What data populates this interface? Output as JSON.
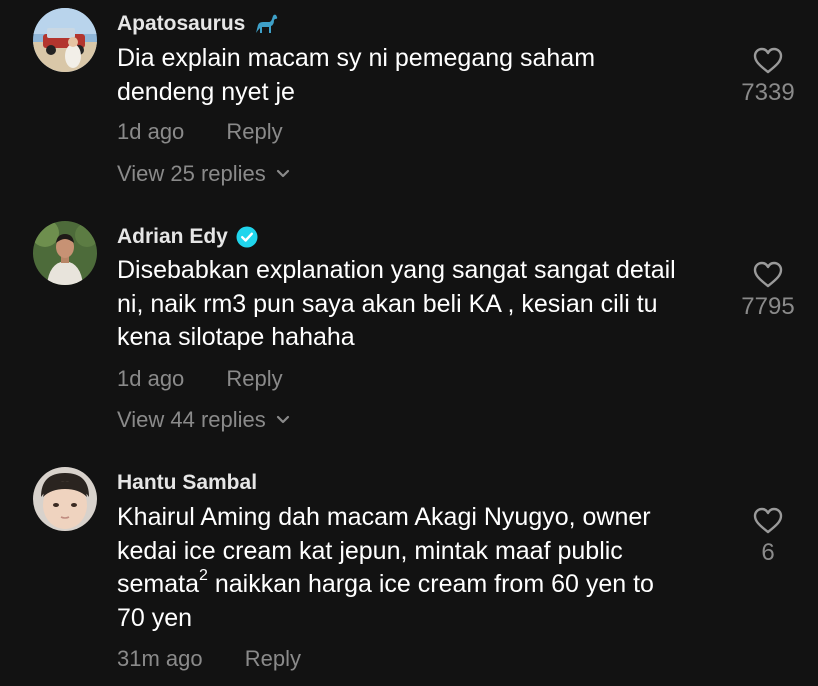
{
  "comments": [
    {
      "username": "Apatosaurus",
      "text_lines": [
        "Dia explain macam sy ni pemegang saham",
        "dendeng nyet je"
      ],
      "time": "1d ago",
      "reply_label": "Reply",
      "view_replies": "View 25 replies",
      "likes": "7339"
    },
    {
      "username": "Adrian Edy",
      "text_lines": [
        "Disebabkan explanation yang sangat sangat detail",
        "ni, naik rm3 pun saya akan beli KA , kesian cili tu",
        "kena silotape hahaha"
      ],
      "time": "1d ago",
      "reply_label": "Reply",
      "view_replies": "View 44 replies",
      "likes": "7795"
    },
    {
      "username": "Hantu Sambal",
      "text_lines": [
        "Khairul Aming dah macam Akagi Nyugyo, owner",
        "kedai ice cream kat jepun, mintak maaf public",
        "semata",
        "2",
        " naikkan harga ice cream from 60 yen to",
        "70 yen"
      ],
      "time": "31m ago",
      "reply_label": "Reply",
      "likes": "6"
    }
  ],
  "colors": {
    "background": "#121212",
    "text": "#ffffff",
    "secondary": "#8a8a8a",
    "verified": "#20d5ec"
  },
  "icons": [
    "dinosaur-emoji-icon",
    "verified-badge-icon",
    "chevron-down-icon",
    "heart-icon"
  ]
}
